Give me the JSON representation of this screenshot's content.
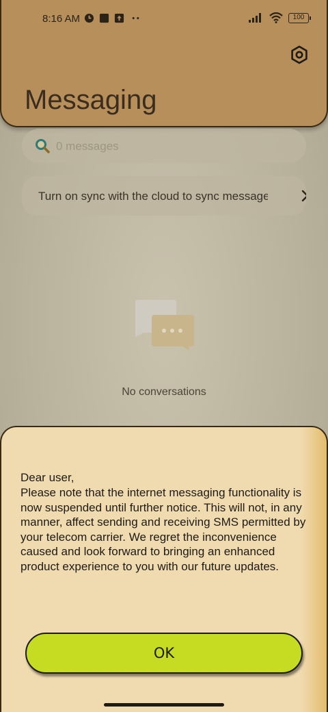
{
  "status_bar": {
    "time": "8:16 AM",
    "battery": "100"
  },
  "header": {
    "title": "Messaging",
    "settings_icon": "gear-icon"
  },
  "search": {
    "placeholder": "0 messages",
    "icon": "search-icon"
  },
  "sync_banner": {
    "text": "Turn on sync with the cloud to sync messages",
    "icon": "chevron-right-icon"
  },
  "empty_state": {
    "icon": "chat-bubbles-icon",
    "text": "No conversations"
  },
  "dialog": {
    "greeting": "Dear user,",
    "body": "Please note that the internet messaging functionality is now suspended until further notice. This will not, in any manner, affect sending and receiving SMS permitted by your telecom carrier. We regret the inconvenience caused and look forward to bringing an enhanced product experience to you with our future updates.",
    "ok_label": "OK"
  },
  "colors": {
    "header_bg": "#b78f5b",
    "dialog_bg": "#f0dbb0",
    "ok_button": "#c5dc22"
  }
}
